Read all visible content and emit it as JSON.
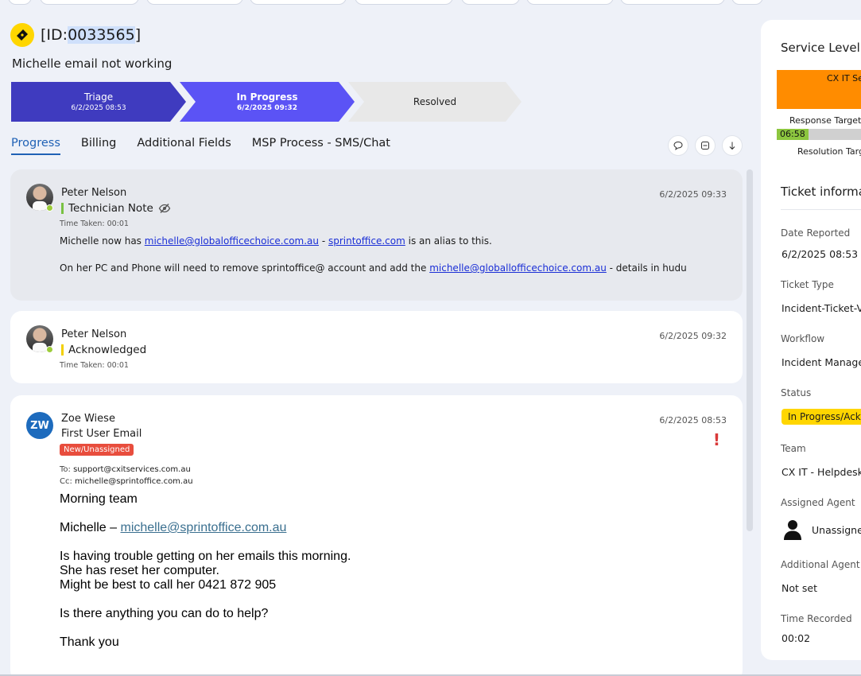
{
  "ticket": {
    "id_prefix": "[ID:",
    "id_number": "0033565",
    "id_suffix": "]",
    "title": "Michelle email not working"
  },
  "stages": [
    {
      "name": "Triage",
      "date": "6/2/2025 08:53"
    },
    {
      "name": "In Progress",
      "date": "6/2/2025 09:32"
    },
    {
      "name": "Resolved",
      "date": ""
    }
  ],
  "tabs": [
    "Progress",
    "Billing",
    "Additional Fields",
    "MSP Process - SMS/Chat"
  ],
  "feed": [
    {
      "author": "Peter Nelson",
      "type": "Technician Note",
      "type_color": "#79c142",
      "time_taken": "Time Taken: 00:01",
      "date": "6/2/2025 09:33",
      "line1_pre": "Michelle now has ",
      "line1_link1": "michelle@globalofficechoice.com.au",
      "line1_mid": " - ",
      "line1_link2": "sprintoffice.com",
      "line1_post": " is an alias to this.",
      "line2_pre": "On her PC and Phone will need to remove sprintoffice@ account and add the ",
      "line2_link": "michelle@globallofficechoice.com.au",
      "line2_post": " - details in hudu"
    },
    {
      "author": "Peter Nelson",
      "type": "Acknowledged",
      "type_color": "#f3d000",
      "time_taken": "Time Taken: 00:01",
      "date": "6/2/2025 09:32"
    },
    {
      "author": "Zoe Wiese",
      "initials": "ZW",
      "type": "First User Email",
      "badge": "New/Unassigned",
      "date": "6/2/2025 08:53",
      "to_label": "To: ",
      "to": "support@cxitservices.com.au",
      "cc_label": "Cc: ",
      "cc": "michelle@sprintoffice.com.au",
      "body_greeting": "Morning team",
      "body_name": "Michelle – ",
      "body_link": "michelle@sprintoffice.com.au",
      "body_l1": "Is having trouble getting on her emails this morning.",
      "body_l2": "She has reset her computer.",
      "body_l3": "Might be best to call her 0421 872 905",
      "body_l4": "Is there anything you can do to help?",
      "body_l5": "Thank you"
    }
  ],
  "sidebar": {
    "sla_title": "Service Level A",
    "sla_name": "CX IT Se",
    "sla_mark": "I",
    "response_label": "Response Target",
    "response_time": "06:58",
    "resolution_label": "Resolution Targ",
    "info_title": "Ticket informa",
    "fields": [
      {
        "label": "Date Reported",
        "value": "6/2/2025 08:53"
      },
      {
        "label": "Ticket Type",
        "value": "Incident-Ticket-V"
      },
      {
        "label": "Workflow",
        "value": "Incident Manage"
      },
      {
        "label": "Status",
        "value": "In Progress/Ack"
      },
      {
        "label": "Team",
        "value": "CX IT - Helpdesk"
      },
      {
        "label": "Assigned Agent",
        "value": "Unassigne"
      },
      {
        "label": "Additional Agent",
        "value": "Not set"
      },
      {
        "label": "Time Recorded",
        "value": "00:02"
      }
    ]
  },
  "colors": {
    "accent": "#1f61b5",
    "stage_done": "#3f3bbf",
    "stage_current": "#5b53f5",
    "status_yellow": "#ffd600",
    "sla_orange": "#ff8c00",
    "badge_red": "#e84d3d"
  }
}
